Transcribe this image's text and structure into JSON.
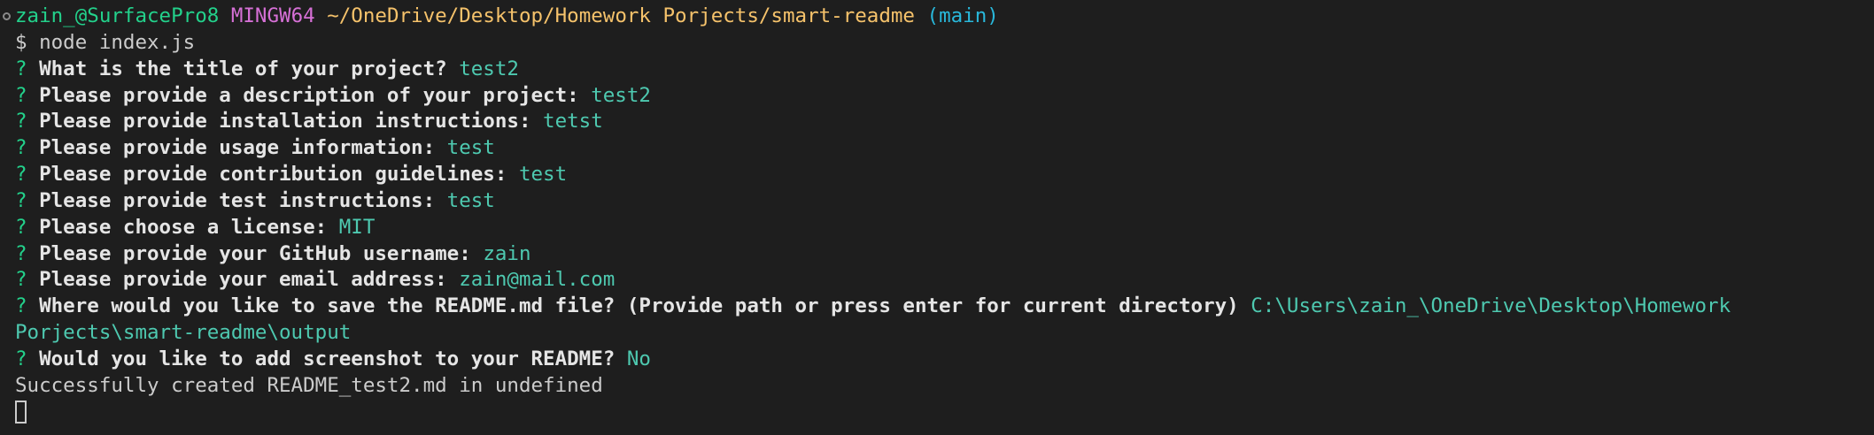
{
  "prompt": {
    "user_host": "zain_@SurfacePro8",
    "system": "MINGW64",
    "path": "~/OneDrive/Desktop/Homework Porjects/smart-readme",
    "branch": "(main)",
    "symbol": "$",
    "command": "node index.js"
  },
  "question_mark": "?",
  "qa": [
    {
      "question": "What is the title of your project?",
      "answer": "test2"
    },
    {
      "question": "Please provide a description of your project:",
      "answer": "test2"
    },
    {
      "question": "Please provide installation instructions:",
      "answer": "tetst"
    },
    {
      "question": "Please provide usage information:",
      "answer": "test"
    },
    {
      "question": "Please provide contribution guidelines:",
      "answer": "test"
    },
    {
      "question": "Please provide test instructions:",
      "answer": "test"
    },
    {
      "question": "Please choose a license:",
      "answer": "MIT"
    },
    {
      "question": "Please provide your GitHub username:",
      "answer": "zain"
    },
    {
      "question": "Please provide your email address:",
      "answer": "zain@mail.com"
    },
    {
      "question": "Where would you like to save the README.md file? (Provide path or press enter for current directory)",
      "answer": "C:\\Users\\zain_\\OneDrive\\Desktop\\Homework",
      "answer_cont": "Porjects\\smart-readme\\output"
    },
    {
      "question": "Would you like to add screenshot to your README?",
      "answer": "No"
    }
  ],
  "result": "Successfully created README_test2.md in undefined"
}
